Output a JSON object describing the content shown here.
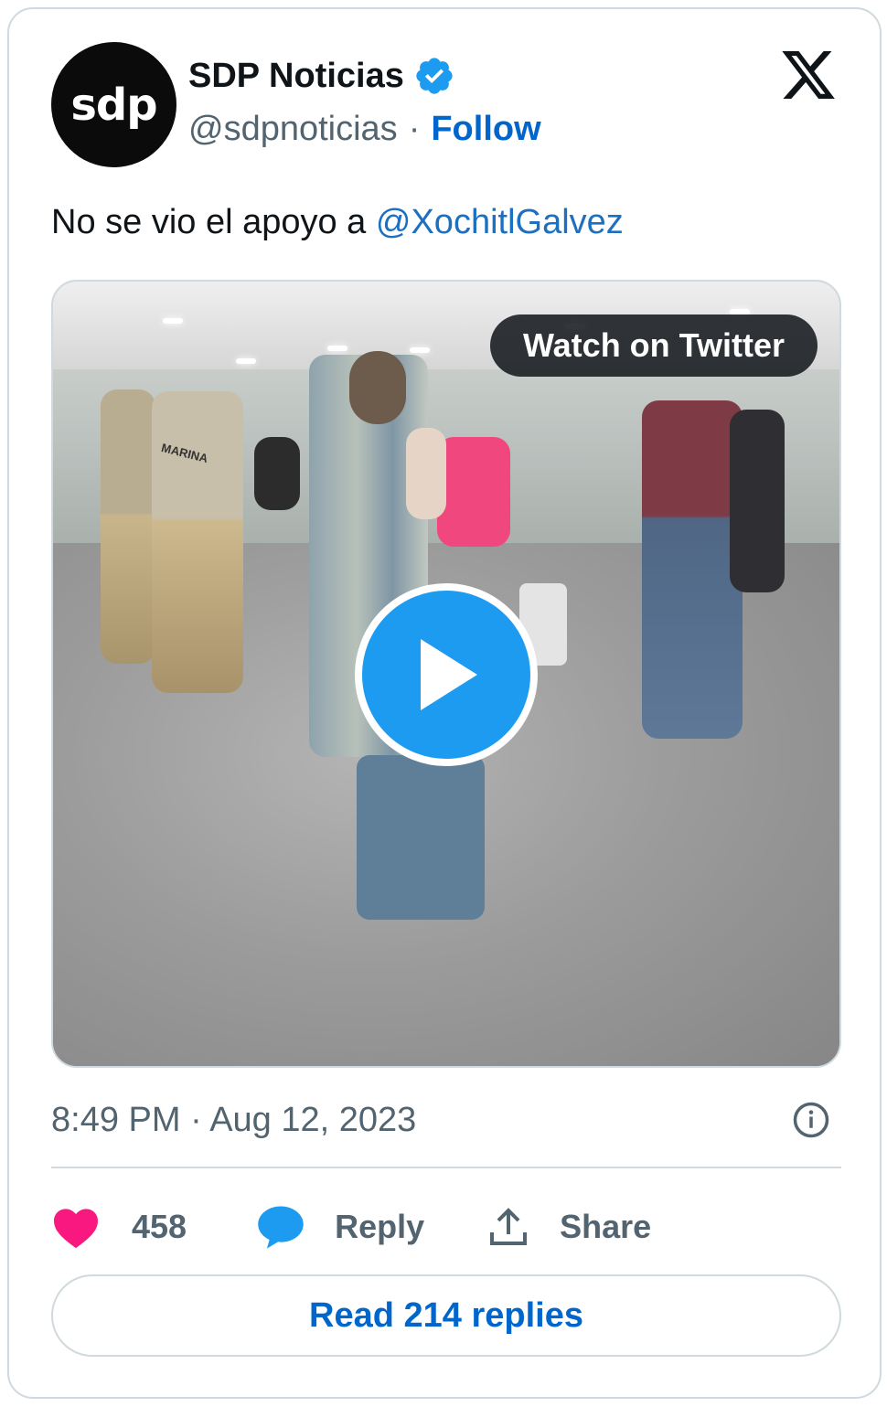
{
  "author": {
    "avatar_text": "sdp",
    "display_name": "SDP Noticias",
    "handle": "@sdpnoticias",
    "separator": "·",
    "follow_label": "Follow"
  },
  "tweet": {
    "text": "No se vio el apoyo a ",
    "mention": "@XochitlGalvez"
  },
  "media": {
    "watch_label": "Watch on Twitter",
    "uniform_text": "MARINA"
  },
  "timestamp": "8:49 PM · Aug 12, 2023",
  "actions": {
    "like_count": "458",
    "reply_label": "Reply",
    "share_label": "Share"
  },
  "read_replies_label": "Read 214 replies",
  "colors": {
    "brand_blue": "#1d9bf0",
    "link_blue": "#0066cc",
    "like_pink": "#f91880",
    "muted": "#536471"
  },
  "icons": [
    "verified-badge-icon",
    "x-logo-icon",
    "play-icon",
    "info-icon",
    "heart-icon",
    "reply-bubble-icon",
    "share-upload-icon"
  ]
}
